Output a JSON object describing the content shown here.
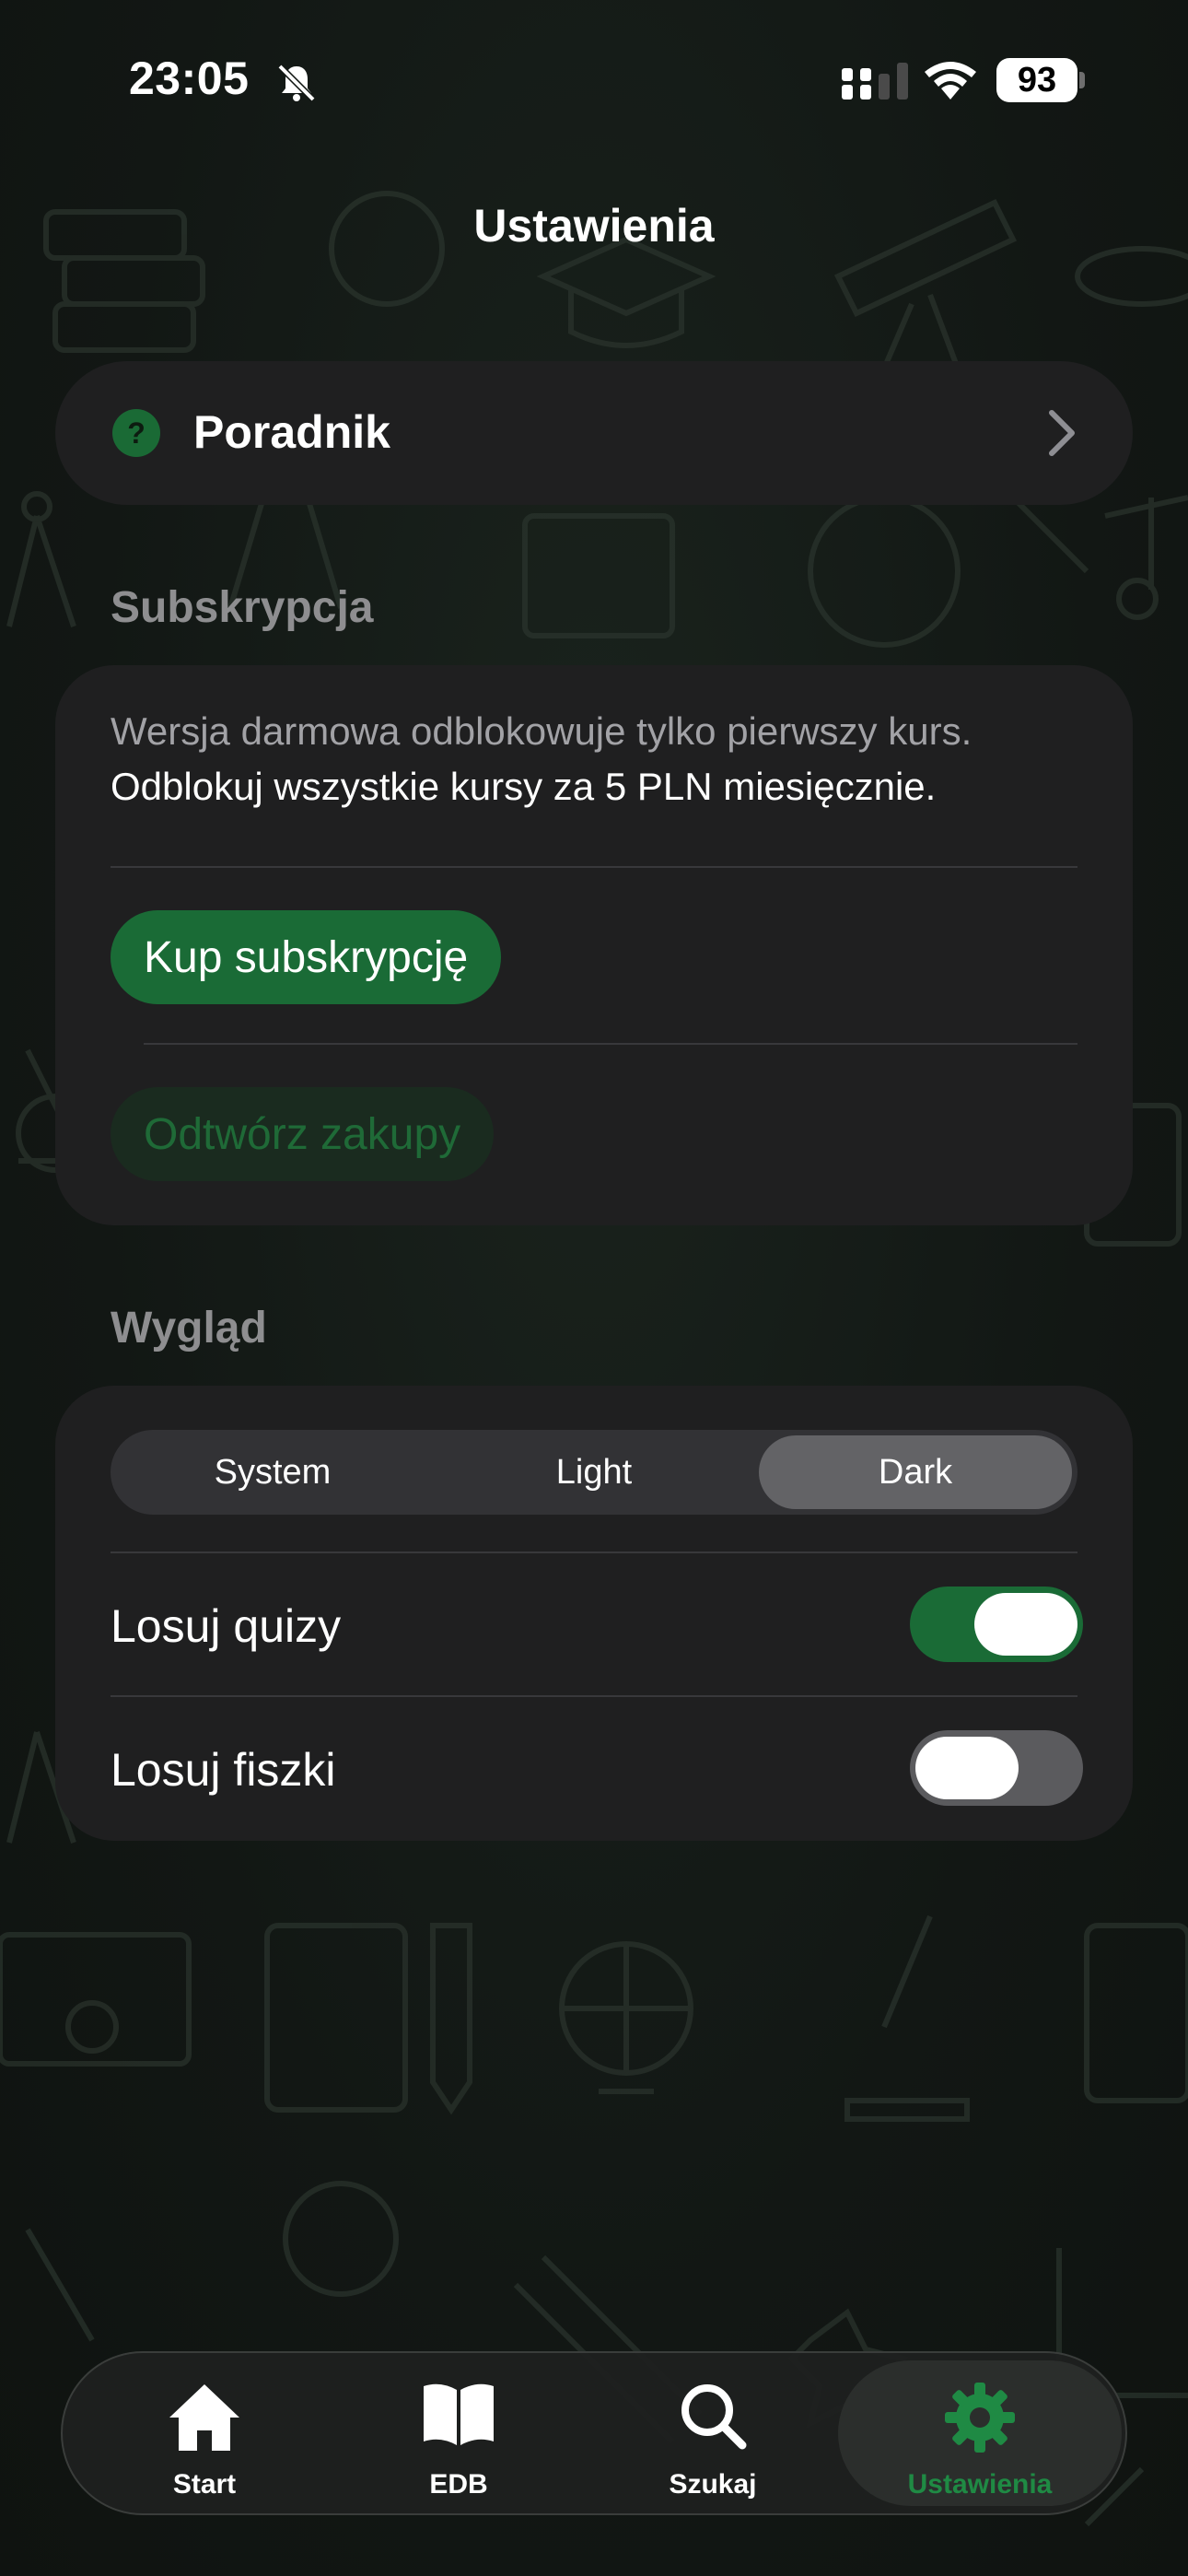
{
  "status_bar": {
    "time": "23:05",
    "battery": "93"
  },
  "nav": {
    "title": "Ustawienia"
  },
  "guide": {
    "label": "Poradnik",
    "icon_glyph": "?"
  },
  "subscription": {
    "header": "Subskrypcja",
    "info_line1": "Wersja darmowa odblokowuje tylko pierwszy kurs.",
    "info_line2": "Odblokuj wszystkie kursy za 5 PLN miesięcznie.",
    "buy_label": "Kup subskrypcję",
    "restore_label": "Odtwórz zakupy"
  },
  "appearance": {
    "header": "Wygląd",
    "segments": [
      "System",
      "Light",
      "Dark"
    ],
    "selected_segment": "Dark",
    "rows": [
      {
        "label": "Losuj quizy",
        "on": true
      },
      {
        "label": "Losuj fiszki",
        "on": false
      }
    ]
  },
  "tabs": [
    {
      "label": "Start",
      "icon": "home-icon"
    },
    {
      "label": "EDB",
      "icon": "book-icon"
    },
    {
      "label": "Szukaj",
      "icon": "search-icon"
    },
    {
      "label": "Ustawienia",
      "icon": "gear-icon",
      "active": true
    }
  ],
  "colors": {
    "accent_green": "#1a6b36",
    "active_tab_label": "#1f8a44",
    "card_bg": "#1f1f20",
    "background": "#121714"
  }
}
